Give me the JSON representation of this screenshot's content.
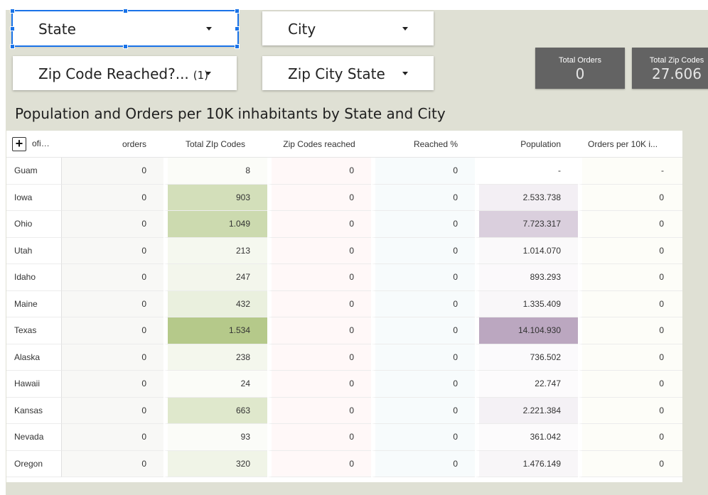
{
  "filters": {
    "state": {
      "label": "State"
    },
    "city": {
      "label": "City"
    },
    "zip_reached": {
      "label": "Zip Code Reached?...",
      "count": "(1)"
    },
    "zip_city_state": {
      "label": "Zip City State"
    }
  },
  "scorecards": {
    "total_orders": {
      "label": "Total Orders",
      "value": "0"
    },
    "total_zip_codes": {
      "label": "Total Zip Codes",
      "value": "27.606"
    }
  },
  "table_title": "Population and Orders per 10K inhabitants by State and City",
  "table": {
    "expand_icon": "plus-box-icon",
    "columns": [
      "oficia...",
      "orders",
      "Total ZIp Codes",
      "Zip Codes reached",
      "Reached %",
      "Population",
      "Orders per 10K i..."
    ],
    "rows": [
      {
        "state": "Guam",
        "orders": "0",
        "zip": "8",
        "reached": "0",
        "pct": "0",
        "pop": "-",
        "per10k": "-"
      },
      {
        "state": "Iowa",
        "orders": "0",
        "zip": "903",
        "reached": "0",
        "pct": "0",
        "pop": "2.533.738",
        "per10k": "0"
      },
      {
        "state": "Ohio",
        "orders": "0",
        "zip": "1.049",
        "reached": "0",
        "pct": "0",
        "pop": "7.723.317",
        "per10k": "0"
      },
      {
        "state": "Utah",
        "orders": "0",
        "zip": "213",
        "reached": "0",
        "pct": "0",
        "pop": "1.014.070",
        "per10k": "0"
      },
      {
        "state": "Idaho",
        "orders": "0",
        "zip": "247",
        "reached": "0",
        "pct": "0",
        "pop": "893.293",
        "per10k": "0"
      },
      {
        "state": "Maine",
        "orders": "0",
        "zip": "432",
        "reached": "0",
        "pct": "0",
        "pop": "1.335.409",
        "per10k": "0"
      },
      {
        "state": "Texas",
        "orders": "0",
        "zip": "1.534",
        "reached": "0",
        "pct": "0",
        "pop": "14.104.930",
        "per10k": "0"
      },
      {
        "state": "Alaska",
        "orders": "0",
        "zip": "238",
        "reached": "0",
        "pct": "0",
        "pop": "736.502",
        "per10k": "0"
      },
      {
        "state": "Hawaii",
        "orders": "0",
        "zip": "24",
        "reached": "0",
        "pct": "0",
        "pop": "22.747",
        "per10k": "0"
      },
      {
        "state": "Kansas",
        "orders": "0",
        "zip": "663",
        "reached": "0",
        "pct": "0",
        "pop": "2.221.384",
        "per10k": "0"
      },
      {
        "state": "Nevada",
        "orders": "0",
        "zip": "93",
        "reached": "0",
        "pct": "0",
        "pop": "361.042",
        "per10k": "0"
      },
      {
        "state": "Oregon",
        "orders": "0",
        "zip": "320",
        "reached": "0",
        "pct": "0",
        "pop": "1.476.149",
        "per10k": "0"
      }
    ]
  },
  "colors": {
    "canvas_bg": "#dfe0d4",
    "selection": "#1a73e8",
    "scorecard_bg": "#636363",
    "zip_heat_max": "#b5c98a",
    "pop_heat_max": "#bba7c0",
    "orders_col_bg": "#f8f8f6",
    "reached_col_bg": "#fff8f8",
    "pct_col_bg": "#f7fbfc",
    "per10k_col_bg": "#fdfdf8"
  }
}
